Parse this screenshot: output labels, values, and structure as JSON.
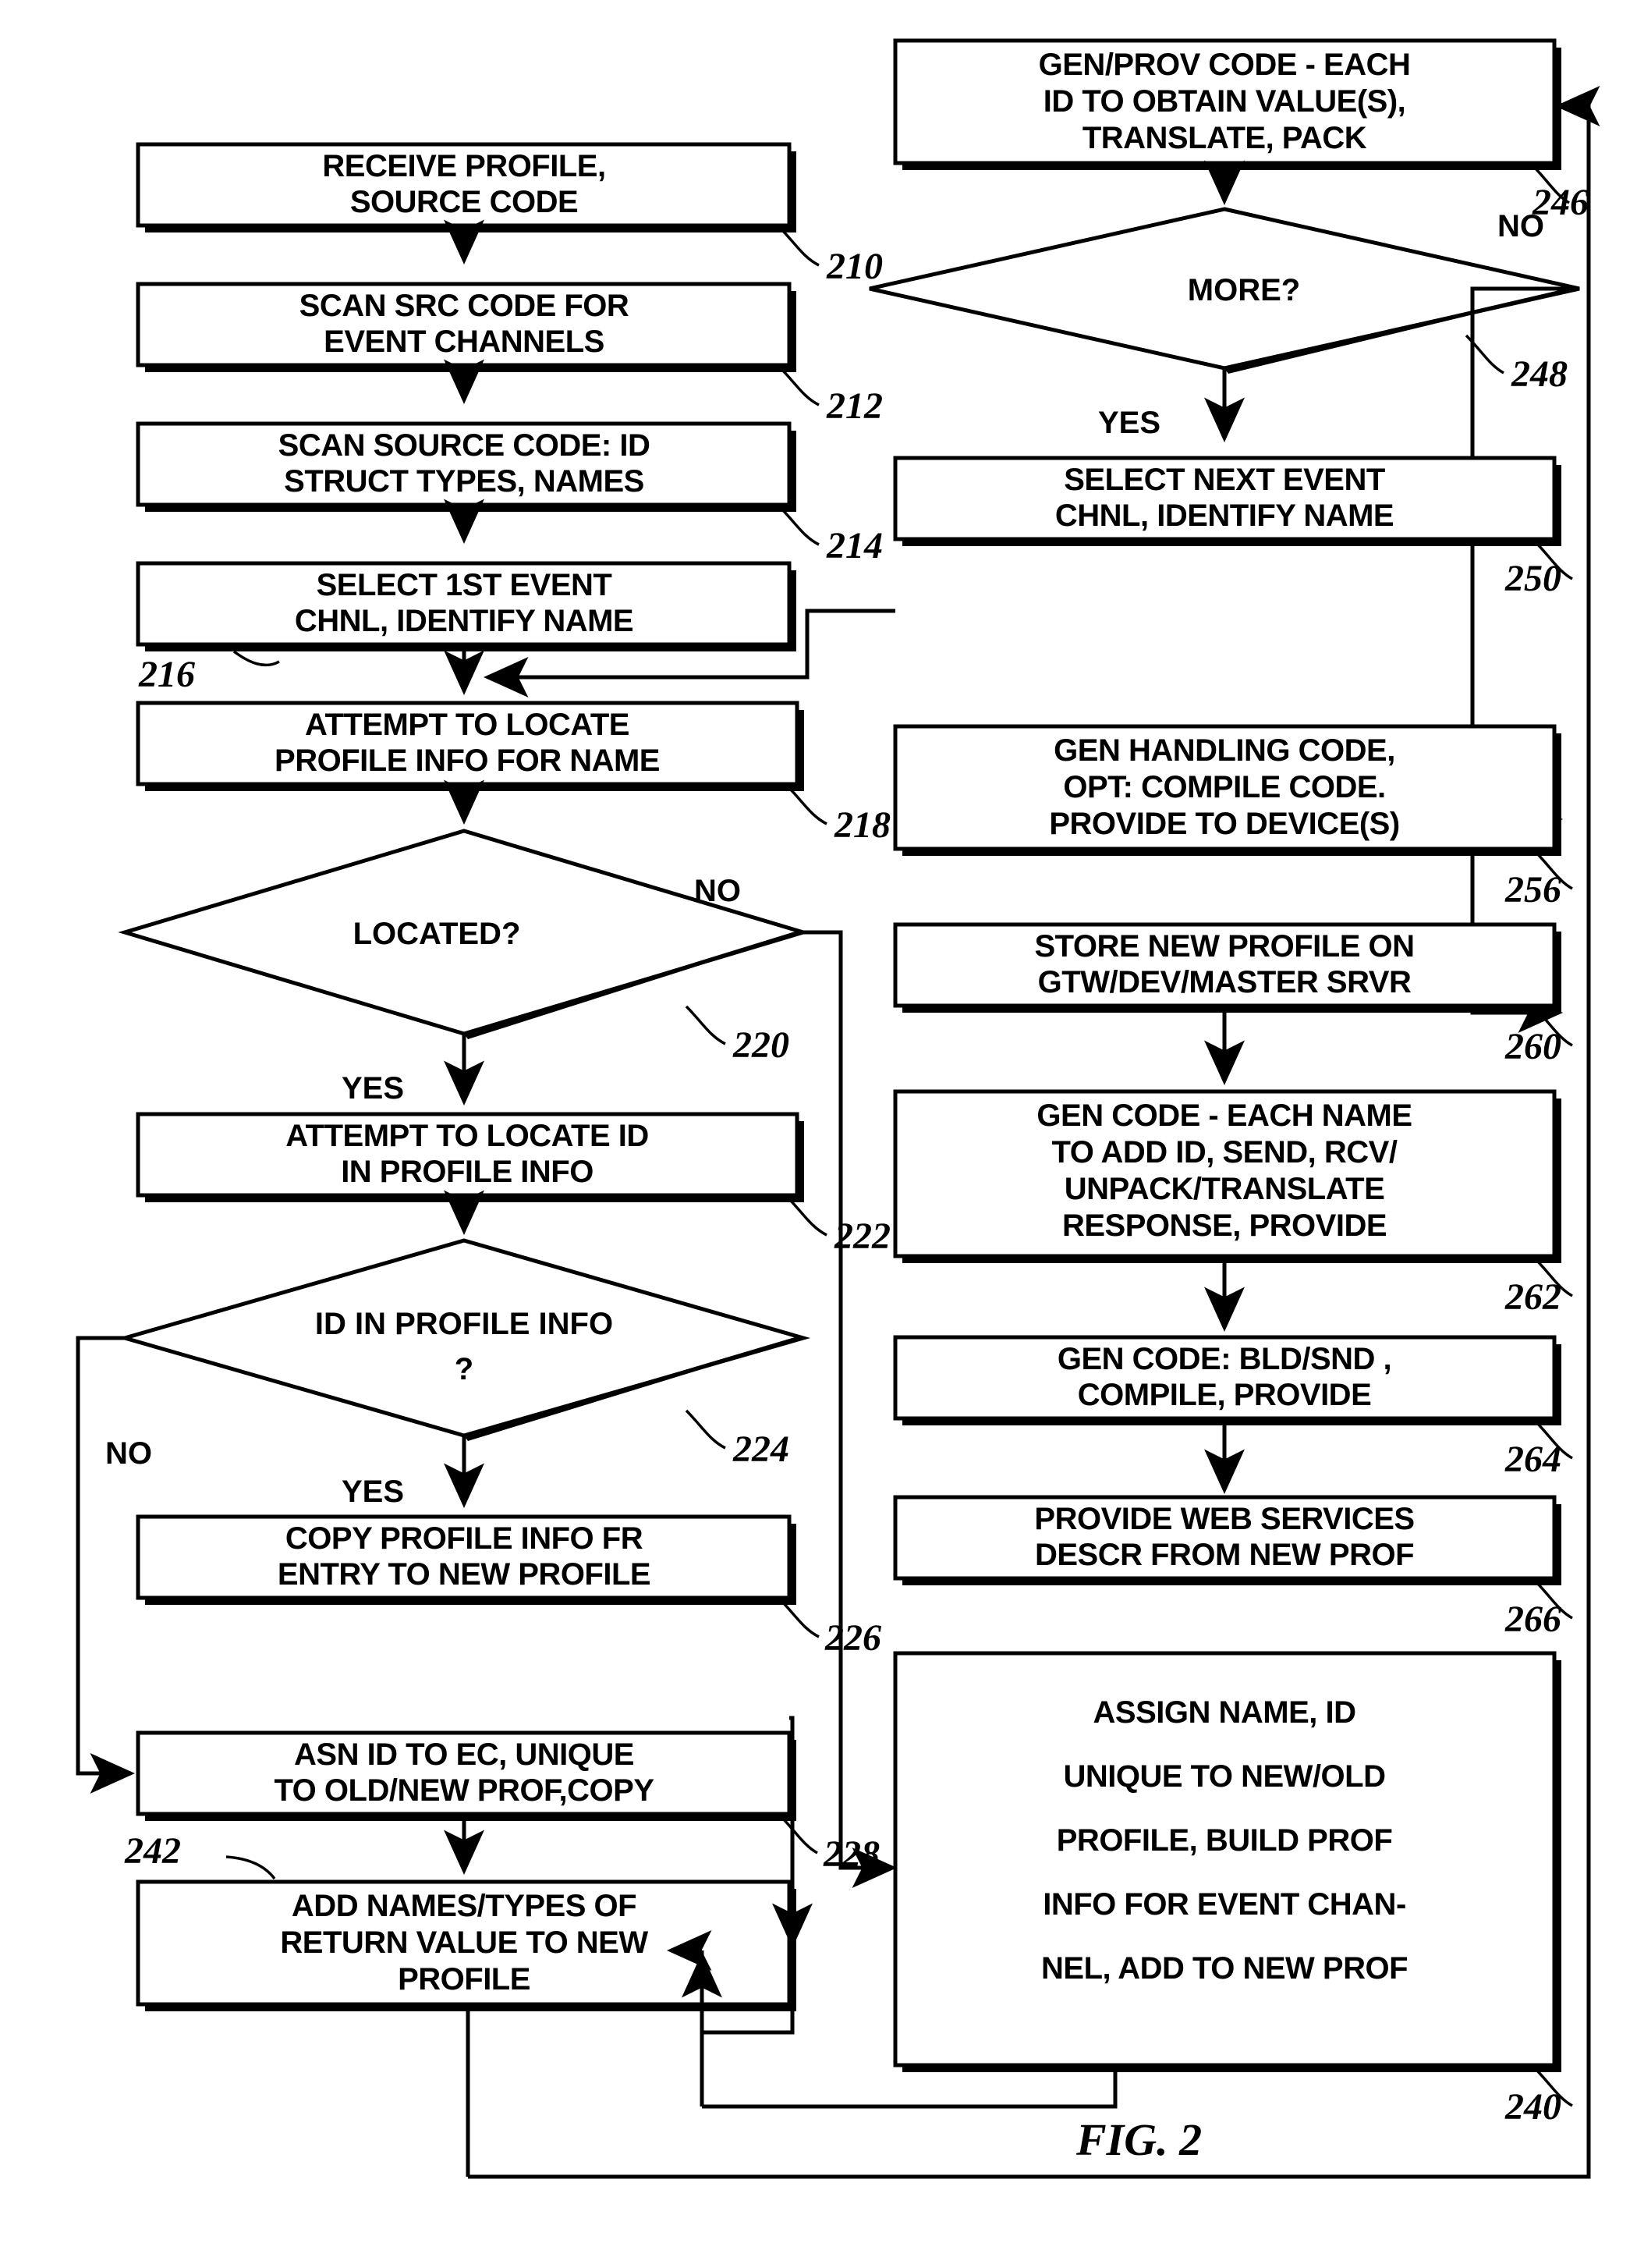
{
  "figure": {
    "label": "FIG. 2",
    "type": "patent-flowchart"
  },
  "nodes": {
    "n210": {
      "ref": "210",
      "shape": "process",
      "lines": [
        "RECEIVE PROFILE,",
        "SOURCE CODE"
      ]
    },
    "n212": {
      "ref": "212",
      "shape": "process",
      "lines": [
        "SCAN SRC CODE FOR",
        "EVENT CHANNELS"
      ]
    },
    "n214": {
      "ref": "214",
      "shape": "process",
      "lines": [
        "SCAN SOURCE CODE: ID",
        "STRUCT TYPES, NAMES"
      ]
    },
    "n216": {
      "ref": "216",
      "shape": "process",
      "lines": [
        "SELECT 1ST EVENT",
        "CHNL, IDENTIFY NAME"
      ]
    },
    "n218": {
      "ref": "218",
      "shape": "process",
      "lines": [
        "ATTEMPT TO LOCATE",
        "PROFILE INFO FOR NAME"
      ]
    },
    "n220": {
      "ref": "220",
      "shape": "decision",
      "lines": [
        "LOCATED?"
      ]
    },
    "n222": {
      "ref": "222",
      "shape": "process",
      "lines": [
        "ATTEMPT TO LOCATE ID",
        "IN PROFILE INFO"
      ]
    },
    "n224": {
      "ref": "224",
      "shape": "decision",
      "lines": [
        "ID IN PROFILE INFO",
        "?"
      ]
    },
    "n226": {
      "ref": "226",
      "shape": "process",
      "lines": [
        "COPY PROFILE INFO FR",
        "ENTRY TO NEW PROFILE"
      ]
    },
    "n228": {
      "ref": "228",
      "shape": "process",
      "lines": [
        "ASN ID TO EC, UNIQUE",
        "TO OLD/NEW PROF,COPY"
      ]
    },
    "n242": {
      "ref": "242",
      "shape": "process",
      "lines": [
        "ADD NAMES/TYPES OF",
        "RETURN VALUE TO NEW",
        "PROFILE"
      ]
    },
    "n246": {
      "ref": "246",
      "shape": "process",
      "lines": [
        "GEN/PROV CODE - EACH",
        "ID TO OBTAIN VALUE(S),",
        "TRANSLATE, PACK"
      ]
    },
    "n248": {
      "ref": "248",
      "shape": "decision",
      "lines": [
        "MORE?"
      ]
    },
    "n250": {
      "ref": "250",
      "shape": "process",
      "lines": [
        "SELECT NEXT EVENT",
        "CHNL, IDENTIFY NAME"
      ]
    },
    "n256": {
      "ref": "256",
      "shape": "process",
      "lines": [
        "GEN HANDLING CODE,",
        "OPT: COMPILE CODE.",
        "PROVIDE TO DEVICE(S)"
      ]
    },
    "n260": {
      "ref": "260",
      "shape": "process",
      "lines": [
        "STORE NEW PROFILE ON",
        "GTW/DEV/MASTER SRVR"
      ]
    },
    "n262": {
      "ref": "262",
      "shape": "process",
      "lines": [
        "GEN CODE - EACH NAME",
        "TO ADD ID, SEND, RCV/",
        "UNPACK/TRANSLATE",
        "RESPONSE, PROVIDE"
      ]
    },
    "n264": {
      "ref": "264",
      "shape": "process",
      "lines": [
        "GEN CODE: BLD/SND ,",
        "COMPILE, PROVIDE"
      ]
    },
    "n266": {
      "ref": "266",
      "shape": "process",
      "lines": [
        "PROVIDE WEB SERVICES",
        "DESCR FROM NEW PROF"
      ]
    },
    "n240": {
      "ref": "240",
      "shape": "process",
      "lines": [
        "ASSIGN NAME, ID",
        "UNIQUE TO NEW/OLD",
        "PROFILE, BUILD PROF",
        "INFO FOR EVENT CHAN-",
        "NEL, ADD TO NEW PROF"
      ]
    }
  },
  "edge_labels": {
    "located_no": "NO",
    "located_yes": "YES",
    "id_no": "NO",
    "id_yes": "YES",
    "more_no": "NO",
    "more_yes": "YES"
  },
  "colors": {
    "ink": "#000000",
    "paper": "#ffffff"
  }
}
